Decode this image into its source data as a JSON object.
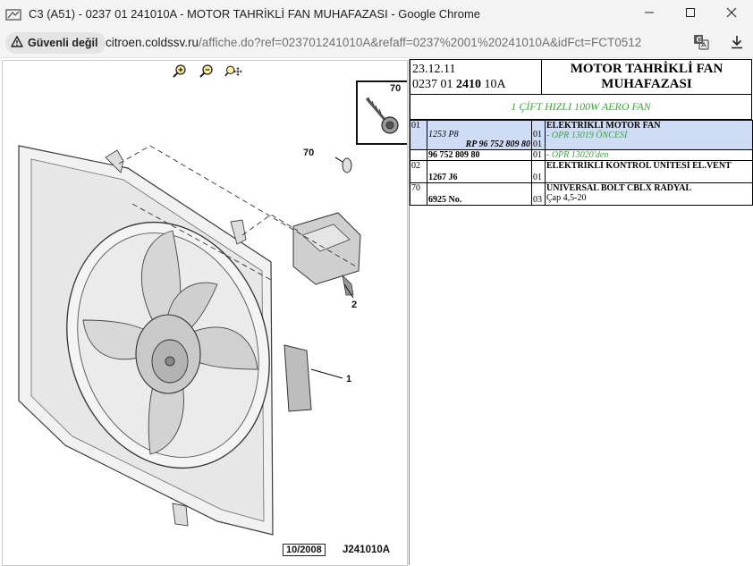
{
  "window": {
    "title": "C3 (A51) - 0237 01 241010A - MOTOR TAHRİKLİ FAN MUHAFAZASI - Google Chrome",
    "minimize_icon": "minimize-icon",
    "maximize_icon": "maximize-icon",
    "close_icon": "close-icon"
  },
  "addressbar": {
    "security_label": "Güvenli değil",
    "url_host": "citroen.coldssv.ru",
    "url_rest": "/affiche.do?ref=023701241010A&refaff=0237%2001%20241010A&idFct=FCT0512",
    "translate_icon": "translate-icon",
    "download_icon": "download-icon"
  },
  "viewer": {
    "tools": [
      "zoom-in-icon",
      "zoom-out-icon",
      "zoom-pan-icon"
    ],
    "callouts": {
      "c70_thumb": "70",
      "c70": "70",
      "c2": "2",
      "c1": "1"
    },
    "date_code": "10/2008",
    "ref_code": "J241010A"
  },
  "header": {
    "date": "23.12.11",
    "ref_prefix": "0237 01 ",
    "ref_bold": "2410",
    "ref_suffix": " 10A",
    "title_line1": "MOTOR TAHRİKLİ FAN",
    "title_line2": "MUHAFAZASI"
  },
  "subtitle": "1 ÇİFT HIZLI 100W AERO FAN",
  "parts": [
    {
      "no": "01",
      "ref1": "1253 P8",
      "ref2": "RP 96 752 809 80",
      "ref3": "96 752 809 80",
      "q1": "01",
      "q2": "01",
      "q3": "01",
      "desc": "ELEKTRİKLİ MOTOR FAN",
      "note1": "- OPR 13019 ÖNCESİ",
      "note2": "- OPR 13020'den"
    },
    {
      "no": "02",
      "ref": "1267 J6",
      "q": "01",
      "desc": "ELEKTRİKLİ KONTROL ÜNİTESİ EL.VENT"
    },
    {
      "no": "70",
      "ref": "6925 No.",
      "q": "03",
      "desc": "UNIVERSAL BOLT CBLX RADYAL",
      "desc2": "Çap 4,5-20"
    }
  ]
}
